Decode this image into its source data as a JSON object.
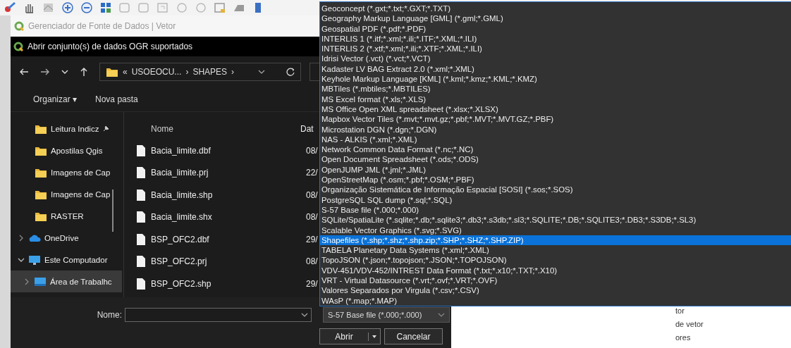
{
  "window": {
    "title": "Gerenciador de Fonte de Dados | Vetor"
  },
  "dialog": {
    "title": "Abrir conjunto(s) de dados OGR suportados",
    "address": {
      "crumbs": [
        "«",
        "USOEOCU...",
        "›",
        "SHAPES",
        "›"
      ]
    },
    "toolbar": [
      "Organizar ▾",
      "Nova pasta"
    ],
    "sidebar": [
      {
        "label": "Leitura Indicz",
        "kind": "folder",
        "pinned": true,
        "selected": false
      },
      {
        "label": "Apostilas Qgis",
        "kind": "folder",
        "pinned": false,
        "selected": false
      },
      {
        "label": "Imagens de Cap",
        "kind": "folder",
        "pinned": false,
        "selected": false
      },
      {
        "label": "Imagens de Cap",
        "kind": "folder",
        "pinned": false,
        "selected": false
      },
      {
        "label": "RASTER",
        "kind": "folder",
        "pinned": false,
        "selected": false
      },
      {
        "label": "OneDrive",
        "kind": "cloud",
        "pinned": false,
        "selected": false,
        "expanded": false
      },
      {
        "label": "Este Computador",
        "kind": "computer",
        "pinned": false,
        "selected": false,
        "expanded": true
      },
      {
        "label": "Área de Trabalhc",
        "kind": "desktop",
        "pinned": false,
        "selected": true,
        "expanded": false
      }
    ],
    "columns": [
      "Nome",
      "Dat"
    ],
    "files": [
      {
        "name": "Bacia_limite.dbf",
        "date": "08/"
      },
      {
        "name": "Bacia_limite.prj",
        "date": "22/"
      },
      {
        "name": "Bacia_limite.shp",
        "date": "08/"
      },
      {
        "name": "Bacia_limite.shx",
        "date": "08/"
      },
      {
        "name": "BSP_OFC2.dbf",
        "date": "29/"
      },
      {
        "name": "BSP_OFC2.prj",
        "date": "08/"
      },
      {
        "name": "BSP_OFC2.shp",
        "date": "29/"
      }
    ],
    "name_label": "Nome:",
    "file_type": "S-57 Base file (*.000;*.000)",
    "buttons": [
      "Abrir",
      "Cancelar"
    ]
  },
  "format_list": [
    {
      "label": "Geoconcept (*.gxt;*.txt;*.GXT;*.TXT)",
      "selected": false
    },
    {
      "label": "Geography Markup Language [GML] (*.gml;*.GML)",
      "selected": false
    },
    {
      "label": "Geospatial PDF (*.pdf;*.PDF)",
      "selected": false
    },
    {
      "label": "INTERLIS 1 (*.itf;*.xml;*.ili;*.ITF;*.XML;*.ILI)",
      "selected": false
    },
    {
      "label": "INTERLIS 2 (*.xtf;*.xml;*.ili;*.XTF;*.XML;*.ILI)",
      "selected": false
    },
    {
      "label": "Idrisi Vector (.vct) (*.vct;*.VCT)",
      "selected": false
    },
    {
      "label": "Kadaster LV BAG Extract 2.0 (*.xml;*.XML)",
      "selected": false
    },
    {
      "label": "Keyhole Markup Language [KML] (*.kml;*.kmz;*.KML;*.KMZ)",
      "selected": false
    },
    {
      "label": "MBTiles (*.mbtiles;*.MBTILES)",
      "selected": false
    },
    {
      "label": "MS Excel format (*.xls;*.XLS)",
      "selected": false
    },
    {
      "label": "MS Office Open XML spreadsheet (*.xlsx;*.XLSX)",
      "selected": false
    },
    {
      "label": "Mapbox Vector Tiles (*.mvt;*.mvt.gz;*.pbf;*.MVT;*.MVT.GZ;*.PBF)",
      "selected": false
    },
    {
      "label": "Microstation DGN (*.dgn;*.DGN)",
      "selected": false
    },
    {
      "label": "NAS - ALKIS (*.xml;*.XML)",
      "selected": false
    },
    {
      "label": "Network Common Data Format (*.nc;*.NC)",
      "selected": false
    },
    {
      "label": "Open Document Spreadsheet (*.ods;*.ODS)",
      "selected": false
    },
    {
      "label": "OpenJUMP JML (*.jml;*.JML)",
      "selected": false
    },
    {
      "label": "OpenStreetMap (*.osm;*.pbf;*.OSM;*.PBF)",
      "selected": false
    },
    {
      "label": "Organização Sistemática de Informação Espacial [SOSI] (*.sos;*.SOS)",
      "selected": false
    },
    {
      "label": "PostgreSQL SQL dump (*.sql;*.SQL)",
      "selected": false
    },
    {
      "label": "S-57 Base file (*.000;*.000)",
      "selected": false
    },
    {
      "label": "SQLite/SpatiaLite (*.sqlite;*.db;*.sqlite3;*.db3;*.s3db;*.sl3;*.SQLITE;*.DB;*.SQLITE3;*.DB3;*.S3DB;*.SL3)",
      "selected": false
    },
    {
      "label": "Scalable Vector Graphics (*.svg;*.SVG)",
      "selected": false
    },
    {
      "label": "Shapefiles (*.shp;*.shz;*.shp.zip;*.SHP;*.SHZ;*.SHP.ZIP)",
      "selected": true
    },
    {
      "label": "TABELA Planetary Data Systems (*.xml;*.XML)",
      "selected": false
    },
    {
      "label": "TopoJSON (*.json;*.topojson;*.JSON;*.TOPOJSON)",
      "selected": false
    },
    {
      "label": "VDV-451/VDV-452/INTREST Data Format (*.txt;*.x10;*.TXT;*.X10)",
      "selected": false
    },
    {
      "label": "VRT - Virtual Datasource (*.vrt;*.ovf;*.VRT;*.OVF)",
      "selected": false
    },
    {
      "label": "Valores Separados por Virgula (*.csv;*.CSV)",
      "selected": false
    },
    {
      "label": "WAsP (*.map;*.MAP)",
      "selected": false
    }
  ],
  "background_list": [
    "tor",
    "de vetor",
    "ores"
  ]
}
